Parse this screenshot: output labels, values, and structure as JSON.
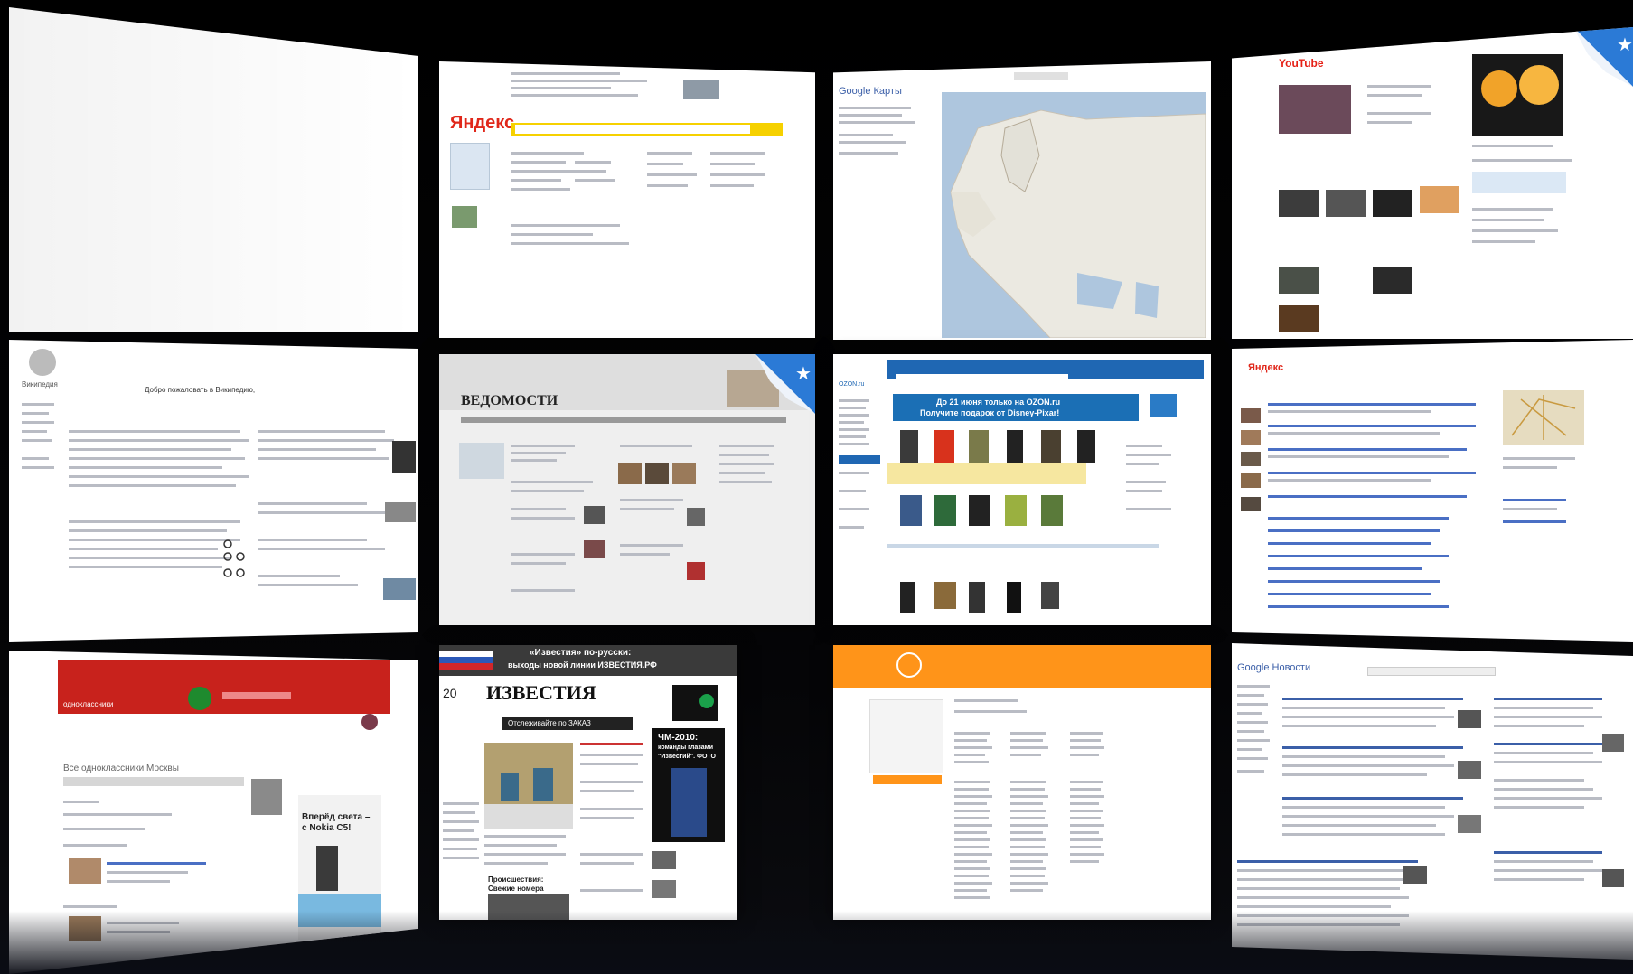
{
  "app": {
    "view": "Top Sites"
  },
  "colors": {
    "background": "#000000",
    "yandex_red": "#e0271a",
    "yandex_yellow": "#f6d100",
    "odnoklassniki_red": "#c8221c",
    "izvestia_ad_red": "#d81d1d",
    "ozon_blue": "#1f67b3",
    "ozon_banner": "#1b6fb5",
    "orange_header": "#ff9419",
    "pin_blue": "#2b7ad6"
  },
  "tiles": [
    {
      "id": "blank",
      "text": {}
    },
    {
      "id": "yandex",
      "text": {
        "logo": "Яндекс"
      }
    },
    {
      "id": "google-maps",
      "text": {
        "logo": "Google Карты"
      }
    },
    {
      "id": "youtube",
      "text": {
        "logo": "YouTube"
      }
    },
    {
      "id": "wikipedia",
      "text": {
        "logo": "Википедия",
        "heading": "Добро пожаловать в Википедию,"
      }
    },
    {
      "id": "vedomosti",
      "text": {
        "logo": "ВЕДОМОСТИ"
      }
    },
    {
      "id": "ozon",
      "text": {
        "logo": "OZON.ru",
        "banner_line1": "До 21 июня только на OZON.ru",
        "banner_line2": "Получите подарок от Disney-Pixar!"
      }
    },
    {
      "id": "yandex-news",
      "text": {
        "logo": "Яндекс"
      }
    },
    {
      "id": "odnoklassniki",
      "text": {
        "logo": "одноклассники",
        "search_title": "Все одноклассники Москвы",
        "ad_line1": "Вперёд света –",
        "ad_line2": "с Nokia C5!"
      }
    },
    {
      "id": "izvestia",
      "text": {
        "top_banner_line1": "«Известия» по-русски:",
        "top_banner_line2": "выходы новой линии ИЗВЕСТИЯ.РФ",
        "logo": "ИЗВЕСТИЯ",
        "side_tag": "20",
        "promo": "Отслеживайте по ЗАКАЗ",
        "wc_title": "ЧМ-2010:",
        "wc_line2": "команды глазами",
        "wc_line3": "\"Известий\". ФОТО",
        "news_label": "Происшествия:",
        "news_label2": "Свежие номера"
      }
    },
    {
      "id": "orange-site",
      "text": {}
    },
    {
      "id": "google-news",
      "text": {
        "logo": "Google Новости"
      }
    }
  ]
}
